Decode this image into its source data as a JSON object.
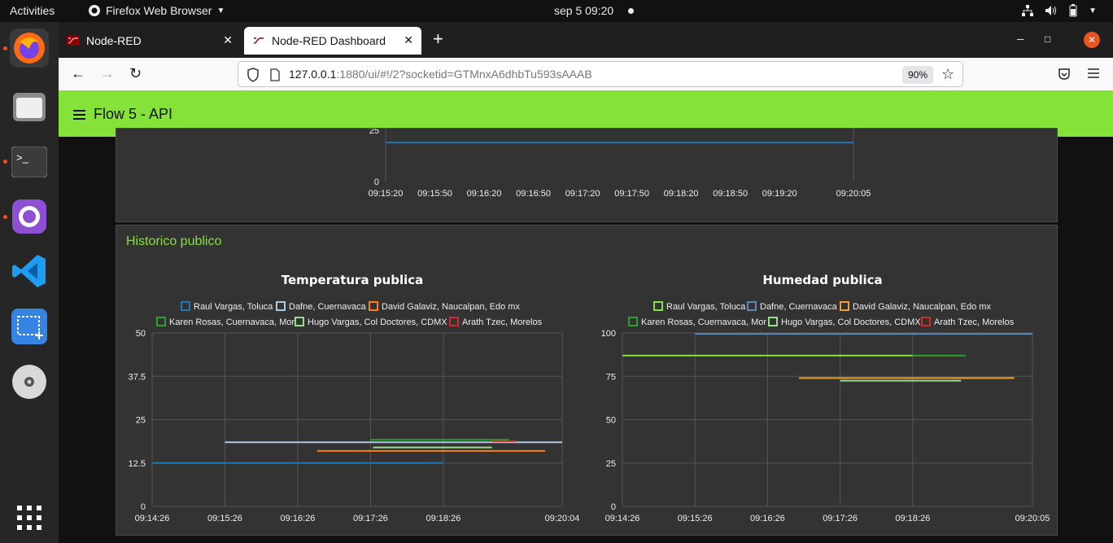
{
  "system": {
    "activities": "Activities",
    "app_name": "Firefox Web Browser",
    "clock": "sep 5  09:20"
  },
  "browser": {
    "tabs": [
      {
        "label": "Node-RED",
        "active": false
      },
      {
        "label": "Node-RED Dashboard",
        "active": true
      }
    ],
    "url": {
      "host": "127.0.0.1",
      "rest": ":1880/ui/#!/2?socketid=GTMnxA6dhbTu593sAAAB"
    },
    "zoom": "90%"
  },
  "dashboard": {
    "title": "Flow 5 - API",
    "accent": "#85e238",
    "group_title": "Historico publico"
  },
  "chart_data": [
    {
      "type": "line",
      "title": "",
      "x_ticks": [
        "09:15:20",
        "09:15:50",
        "09:16:20",
        "09:16:50",
        "09:17:20",
        "09:17:50",
        "09:18:20",
        "09:18:50",
        "09:19:20",
        "09:20:05"
      ],
      "y_ticks": [
        0,
        25
      ],
      "series": [
        {
          "color": "#1f77b4",
          "x": [
            "09:15:20",
            "09:20:05"
          ],
          "y": [
            19,
            19
          ]
        }
      ]
    },
    {
      "type": "line",
      "title": "Temperatura publica",
      "ylim": [
        0,
        50
      ],
      "y_ticks": [
        "0",
        "12.5",
        "25",
        "37.5",
        "50"
      ],
      "x_ticks": [
        "09:14:26",
        "09:15:26",
        "09:16:26",
        "09:17:26",
        "09:18:26",
        "09:20:04"
      ],
      "legend": "top",
      "grid": true,
      "series": [
        {
          "name": "Raul Vargas, Toluca",
          "color": "#1f77b4",
          "x": [
            "09:14:26",
            "09:18:26"
          ],
          "y": [
            12.5,
            12.5
          ]
        },
        {
          "name": "Dafne, Cuernavaca",
          "color": "#aec7e8",
          "x": [
            "09:15:26",
            "09:20:04"
          ],
          "y": [
            18.5,
            18.5
          ]
        },
        {
          "name": "David Galaviz, Naucalpan, Edo mx",
          "color": "#ff7f0e",
          "x": [
            "09:16:42",
            "09:19:50"
          ],
          "y": [
            16,
            16
          ]
        },
        {
          "name": "Karen Rosas, Cuernavaca, Mor",
          "color": "#2ca02c",
          "x": [
            "09:17:26",
            "09:19:20"
          ],
          "y": [
            19.2,
            19.2
          ]
        },
        {
          "name": "Hugo Vargas, Col Doctores, CDMX",
          "color": "#98df8a",
          "x": [
            "09:17:28",
            "09:19:06"
          ],
          "y": [
            17,
            17
          ]
        },
        {
          "name": "Arath Tzec, Morelos",
          "color": "#d62728",
          "x": [
            "09:19:06",
            "09:19:26"
          ],
          "y": [
            18.8,
            18.8
          ]
        }
      ]
    },
    {
      "type": "line",
      "title": "Humedad publica",
      "ylim": [
        0,
        100
      ],
      "y_ticks": [
        "0",
        "25",
        "50",
        "75",
        "100"
      ],
      "x_ticks": [
        "09:14:26",
        "09:15:26",
        "09:16:26",
        "09:17:26",
        "09:18:26",
        "09:20:05"
      ],
      "legend": "top",
      "grid": true,
      "series": [
        {
          "name": "Raul Vargas, Toluca",
          "color": "#85e238",
          "x": [
            "09:14:26",
            "09:18:26"
          ],
          "y": [
            87,
            87
          ]
        },
        {
          "name": "Dafne, Cuernavaca",
          "color": "#5b87b8",
          "x": [
            "09:15:26",
            "09:20:05"
          ],
          "y": [
            99.5,
            99.5
          ]
        },
        {
          "name": "David Galaviz, Naucalpan, Edo mx",
          "color": "#f0a030",
          "x": [
            "09:16:52",
            "09:19:50"
          ],
          "y": [
            74,
            74
          ]
        },
        {
          "name": "Karen Rosas, Cuernavaca, Mor",
          "color": "#2ca02c",
          "x": [
            "09:18:26",
            "09:19:10"
          ],
          "y": [
            87,
            87
          ]
        },
        {
          "name": "Hugo Vargas, Col Doctores, CDMX",
          "color": "#98df8a",
          "x": [
            "09:17:26",
            "09:19:06"
          ],
          "y": [
            72.5,
            72.5
          ]
        },
        {
          "name": "Arath Tzec, Morelos",
          "color": "#d62728",
          "x": [],
          "y": []
        }
      ]
    }
  ]
}
